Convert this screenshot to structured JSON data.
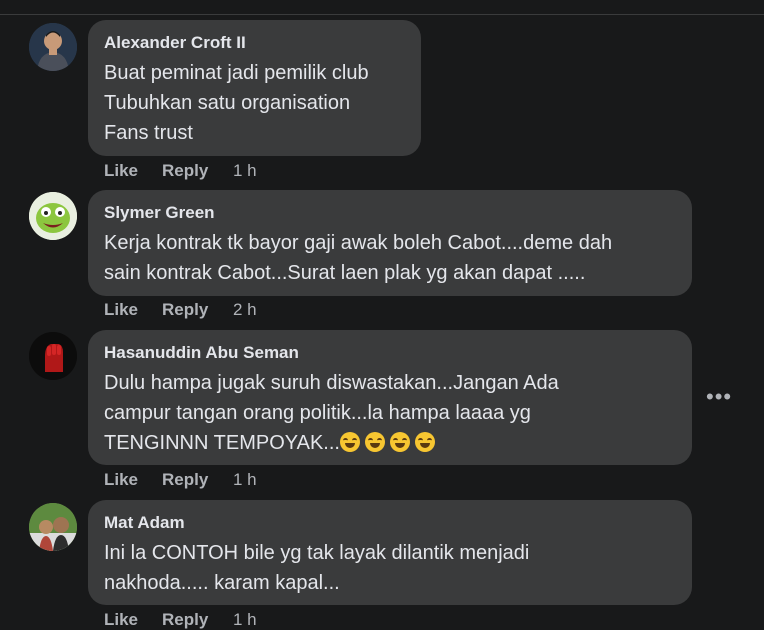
{
  "comments": [
    {
      "author": "Alexander Croft II",
      "lines": [
        "Buat peminat jadi pemilik club",
        "Tubuhkan satu organisation",
        "Fans trust"
      ],
      "like": "Like",
      "reply": "Reply",
      "time": "1 h",
      "avatar_color": "#3d5a7a"
    },
    {
      "author": "Slymer Green",
      "lines": [
        "Kerja kontrak tk bayor gaji awak boleh Cabot....deme dah",
        "sain kontrak Cabot...Surat laen plak yg akan dapat ....."
      ],
      "like": "Like",
      "reply": "Reply",
      "time": "2 h",
      "avatar_color": "#8cc63f"
    },
    {
      "author": "Hasanuddin Abu Seman",
      "lines": [
        "Dulu hampa jugak suruh diswastakan...Jangan Ada",
        "campur tangan orang politik...la hampa laaaa yg",
        "TENGINNN TEMPOYAK..."
      ],
      "like": "Like",
      "reply": "Reply",
      "time": "1 h",
      "avatar_color": "#b01818"
    },
    {
      "author": "Mat Adam",
      "lines": [
        "Ini la CONTOH bile yg tak layak dilantik menjadi",
        "nakhoda..... karam kapal..."
      ],
      "like": "Like",
      "reply": "Reply",
      "time": "1 h",
      "avatar_color": "#4a7d3a"
    }
  ],
  "more_label": "•••"
}
